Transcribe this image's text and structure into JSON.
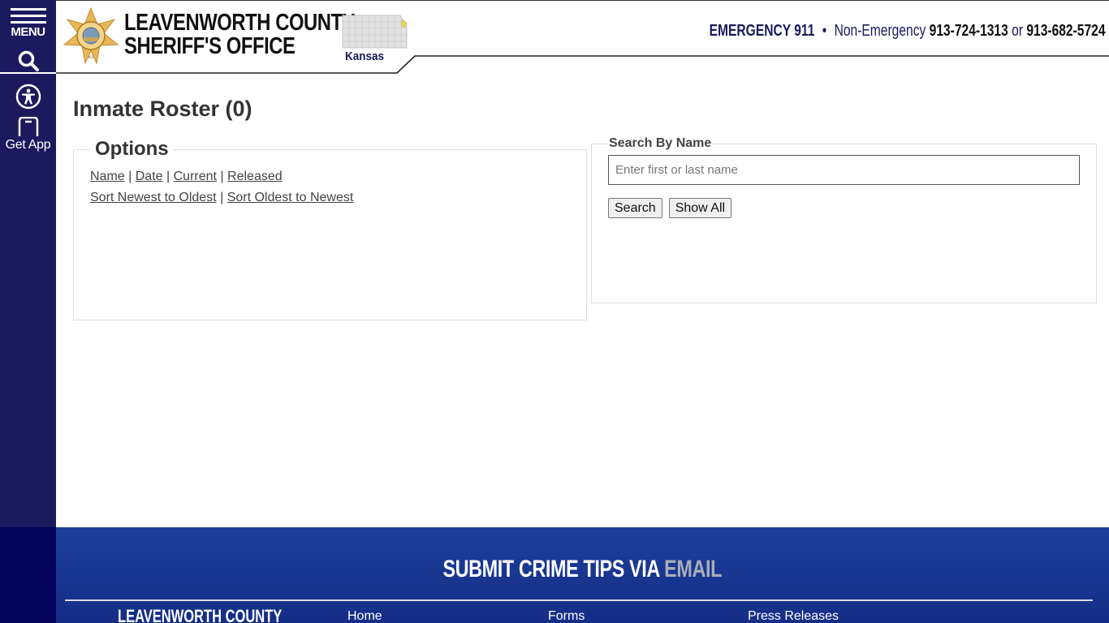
{
  "sidebar": {
    "menu_label": "MENU",
    "app_label": "Get App"
  },
  "header": {
    "org_line1": "LEAVENWORTH COUNTY",
    "org_line2": "SHERIFF'S OFFICE",
    "state_label": "Kansas",
    "emergency_label": "EMERGENCY 911",
    "separator": "•",
    "non_emergency_label": "Non-Emergency",
    "phone_1": "913-724-1313",
    "or_text": "or",
    "phone_2": "913-682-5724"
  },
  "main": {
    "title": "Inmate Roster (0)",
    "options": {
      "legend": "Options",
      "filter_links": [
        "Name",
        "Date",
        "Current",
        "Released"
      ],
      "sort_links": [
        "Sort Newest to Oldest",
        "Sort Oldest to Newest"
      ],
      "divider": "|"
    },
    "search": {
      "legend": "Search By Name",
      "input_value": "",
      "placeholder": "Enter first or last name",
      "search_button": "Search",
      "show_all_button": "Show All"
    }
  },
  "footer": {
    "tips_text": "SUBMIT CRIME TIPS VIA",
    "tips_link": "EMAIL",
    "org_name": "LEAVENWORTH COUNTY",
    "links": [
      "Home",
      "Forms",
      "Press Releases"
    ]
  },
  "colors": {
    "sidebar": "#1c1a5e",
    "sidebar_bottom": "#02025a",
    "footer_top": "#1b3f9a",
    "footer_bottom": "#162d86",
    "tips_link": "#a9adb8"
  }
}
